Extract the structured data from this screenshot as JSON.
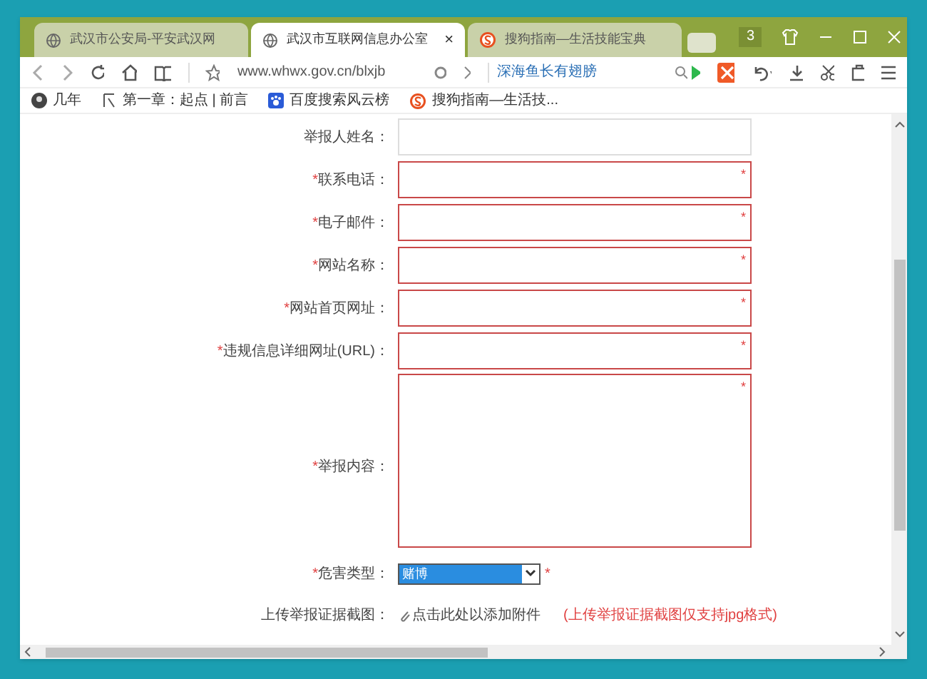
{
  "tabs": [
    {
      "label": "武汉市公安局-平安武汉网",
      "selected": false,
      "kind": "globe"
    },
    {
      "label": "武汉市互联网信息办公室",
      "selected": true,
      "kind": "globe",
      "close": "×"
    },
    {
      "label": "搜狗指南—生活技能宝典",
      "selected": false,
      "kind": "sogou"
    }
  ],
  "tab_count": "3",
  "address_bar": {
    "url": "www.whwx.gov.cn/blxjb",
    "search_hint": "深海鱼长有翅膀"
  },
  "bookmarks": [
    {
      "label": "几年",
      "kind": "avatar"
    },
    {
      "label": "第一章：起点 | 前言",
      "kind": "text"
    },
    {
      "label": "百度搜索风云榜",
      "kind": "paw"
    },
    {
      "label": "搜狗指南—生活技...",
      "kind": "sogou"
    }
  ],
  "form": {
    "fields": [
      {
        "kind": "text",
        "label": "举报人姓名：",
        "required": false
      },
      {
        "kind": "text",
        "marker": "*",
        "label": "联系电话：",
        "required": true,
        "inner_marker": "*"
      },
      {
        "kind": "text",
        "marker": "*",
        "label": "电子邮件：",
        "required": true,
        "inner_marker": "*"
      },
      {
        "kind": "text",
        "marker": "*",
        "label": "网站名称：",
        "required": true,
        "inner_marker": "*"
      },
      {
        "kind": "text",
        "marker": "*",
        "label": "网站首页网址：",
        "required": true,
        "inner_marker": "*"
      },
      {
        "kind": "text",
        "marker": "*",
        "label": "违规信息详细网址(URL)：",
        "required": true,
        "inner_marker": "*"
      },
      {
        "kind": "textarea",
        "marker": "*",
        "label": "举报内容：",
        "required": true,
        "inner_marker": "*"
      },
      {
        "kind": "select",
        "marker": "*",
        "label": "危害类型：",
        "required": true,
        "value": "赌博",
        "after_marker": "*"
      },
      {
        "kind": "upload",
        "label": "上传举报证据截图：",
        "link": "点击此处以添加附件",
        "note": "(上传举报证据截图仅支持jpg格式)"
      }
    ]
  }
}
